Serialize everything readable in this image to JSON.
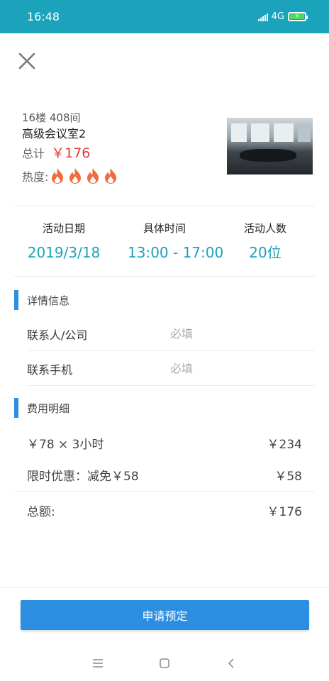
{
  "status_bar": {
    "time": "16:48",
    "network": "4G"
  },
  "room": {
    "floor": "16楼 408间",
    "name": "高级会议室2",
    "total_label": "总计",
    "total_price": "￥176",
    "heat_label": "热度:",
    "heat_level": 4
  },
  "summary": {
    "date_label": "活动日期",
    "date_value": "2019/3/18",
    "time_label": "具体时间",
    "time_value": "13:00 - 17:00",
    "people_label": "活动人数",
    "people_value": "20位"
  },
  "details": {
    "section_title": "详情信息",
    "contact_label": "联系人/公司",
    "contact_placeholder": "必填",
    "phone_label": "联系手机",
    "phone_placeholder": "必填"
  },
  "fees": {
    "section_title": "费用明细",
    "rate_label": "￥78 × 3小时",
    "rate_value": "￥234",
    "discount_label": "限时优惠：减免￥58",
    "discount_value": "￥58",
    "total_label": "总额:",
    "total_value": "￥176"
  },
  "submit_label": "申请预定",
  "colors": {
    "accent": "#1aa3bb",
    "primary": "#2b8ee0",
    "price": "#e53935",
    "flame": "#f26a3d"
  }
}
